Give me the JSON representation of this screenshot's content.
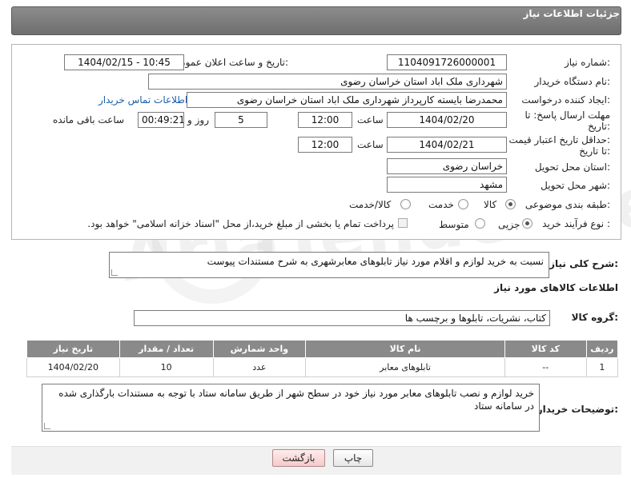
{
  "header": {
    "title": "جزئیات اطلاعات نیاز"
  },
  "form": {
    "need_number_label": "شماره نیاز:",
    "need_number": "1104091726000001",
    "announce_label": "تاریخ و ساعت اعلان عمومی:",
    "announce_value": "1404/02/15 - 10:45",
    "buyer_org_label": "نام دستگاه خریدار:",
    "buyer_org": "شهرداری ملک اباد استان خراسان رضوی",
    "creator_label": "ایجاد کننده درخواست:",
    "creator": "محمدرضا بایسته کارپرداز شهرداری ملک اباد استان خراسان رضوی",
    "contact_link": "اطلاعات تماس خریدار",
    "deadline_label_1": "مهلت ارسال پاسخ: تا",
    "deadline_label_2": "تاریخ:",
    "deadline_date": "1404/02/20",
    "time_label": "ساعت",
    "deadline_time": "12:00",
    "days_value": "5",
    "days_label": "روز و",
    "remaining_time": "00:49:21",
    "remaining_label": "ساعت باقی مانده",
    "validity_label_1": "حداقل تاریخ اعتبار قیمت:",
    "validity_label_2": "تا تاریخ:",
    "validity_date": "1404/02/21",
    "validity_time_label": "ساعت",
    "validity_time": "12:00",
    "province_label": "استان محل تحویل:",
    "province": "خراسان رضوی",
    "city_label": "شهر محل تحویل:",
    "city": "مشهد",
    "category_label": "طبقه بندی موضوعی:",
    "category_options": [
      "کالا",
      "خدمت",
      "کالا/خدمت"
    ],
    "purchase_type_label": "نوع فرآیند خرید :",
    "purchase_type_options": [
      "جزیی",
      "متوسط"
    ],
    "payment_note": "پرداخت تمام یا بخشی از مبلغ خرید،از محل \"اسناد خزانه اسلامی\" خواهد بود."
  },
  "summary": {
    "label": "شرح کلی نیاز:",
    "text": "نسبت به خرید لوازم و اقلام مورد نیاز تابلوهای معابرشهری به شرح مستندات پیوست"
  },
  "goods": {
    "section_title": "اطلاعات کالاهای مورد نیاز",
    "group_label": "گروه کالا:",
    "group_value": "کتاب، نشریات، تابلوها و برچسب ها",
    "columns": [
      "ردیف",
      "کد کالا",
      "نام کالا",
      "واحد شمارش",
      "تعداد / مقدار",
      "تاریخ نیاز"
    ],
    "rows": [
      [
        "1",
        "--",
        "تابلوهای معابر",
        "عدد",
        "10",
        "1404/02/20"
      ]
    ]
  },
  "buyer_notes": {
    "label": "توضیحات خریدار:",
    "text": "خرید لوازم و نصب تابلوهای معابر مورد نیاز خود در سطح شهر از طریق سامانه ستاد با توجه به مستندات بارگذاری شده در سامانه ستاد"
  },
  "buttons": {
    "print": "چاپ",
    "back": "بازگشت"
  },
  "watermark": "AriaTender.neT"
}
